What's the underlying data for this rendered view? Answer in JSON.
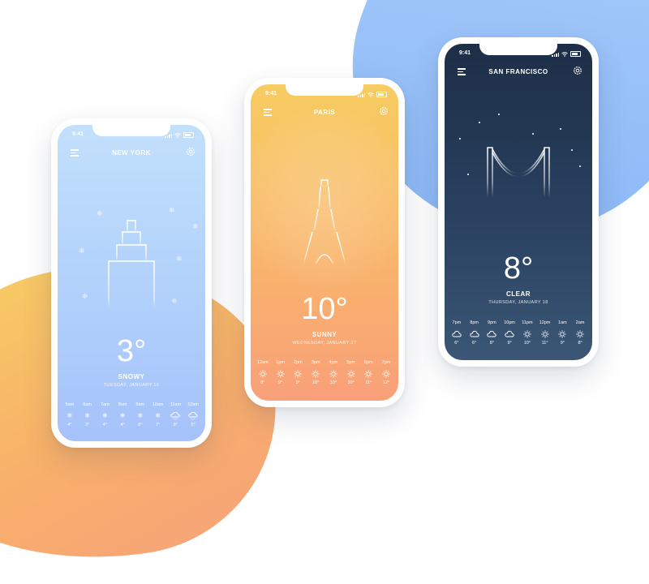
{
  "status": {
    "time": "9:41"
  },
  "colors": {
    "ny_top": "#c2e0fb",
    "ny_bottom": "#a6c2fb",
    "paris_top": "#f7cc61",
    "paris_bottom": "#f9a07a",
    "sf_top": "#1d2e47",
    "sf_bottom": "#3b5676"
  },
  "new_york": {
    "city": "NEW YORK",
    "temperature": "3°",
    "condition": "SNOWY",
    "date": "TUESDAY, JANUARY 16",
    "hourly": [
      {
        "time": "5am",
        "icon": "snow-icon",
        "temp": "4°"
      },
      {
        "time": "6am",
        "icon": "snow-icon",
        "temp": "3°"
      },
      {
        "time": "7am",
        "icon": "snow-icon",
        "temp": "4°"
      },
      {
        "time": "8am",
        "icon": "snow-icon",
        "temp": "4°"
      },
      {
        "time": "9am",
        "icon": "snow-icon",
        "temp": "6°"
      },
      {
        "time": "10am",
        "icon": "snow-icon",
        "temp": "7°"
      },
      {
        "time": "11am",
        "icon": "cloud-snow-icon",
        "temp": "8°"
      },
      {
        "time": "12am",
        "icon": "cloud-snow-icon",
        "temp": "5°"
      }
    ]
  },
  "paris": {
    "city": "PARIS",
    "temperature": "10°",
    "condition": "SUNNY",
    "date": "WEDNESDAY, JANUARY 17",
    "hourly": [
      {
        "time": "12am",
        "icon": "sun-icon",
        "temp": "8°"
      },
      {
        "time": "1pm",
        "icon": "sun-icon",
        "temp": "9°"
      },
      {
        "time": "2pm",
        "icon": "sun-icon",
        "temp": "9°"
      },
      {
        "time": "3pm",
        "icon": "sun-icon",
        "temp": "10°"
      },
      {
        "time": "4pm",
        "icon": "sun-icon",
        "temp": "10°"
      },
      {
        "time": "5pm",
        "icon": "sun-icon",
        "temp": "10°"
      },
      {
        "time": "6pm",
        "icon": "sun-icon",
        "temp": "11°"
      },
      {
        "time": "7pm",
        "icon": "sun-icon",
        "temp": "12°"
      }
    ]
  },
  "san_francisco": {
    "city": "SAN FRANCISCO",
    "temperature": "8°",
    "condition": "CLEAR",
    "date": "THURSDAY, JANUARY 18",
    "hourly": [
      {
        "time": "7pm",
        "icon": "cloud-icon",
        "temp": "6°"
      },
      {
        "time": "8pm",
        "icon": "cloud-icon",
        "temp": "6°"
      },
      {
        "time": "9pm",
        "icon": "cloud-icon",
        "temp": "8°"
      },
      {
        "time": "10pm",
        "icon": "cloud-icon",
        "temp": "9°"
      },
      {
        "time": "11pm",
        "icon": "sun-icon",
        "temp": "10°"
      },
      {
        "time": "12pm",
        "icon": "sun-icon",
        "temp": "11°"
      },
      {
        "time": "1am",
        "icon": "sun-icon",
        "temp": "9°"
      },
      {
        "time": "2am",
        "icon": "sun-icon",
        "temp": "8°"
      }
    ]
  }
}
